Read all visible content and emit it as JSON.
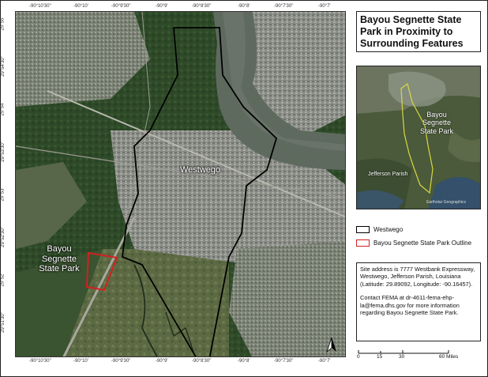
{
  "title": {
    "line1": "Bayou Segnette State",
    "line2": "Park in Proximity to",
    "line3": "Surrounding Features"
  },
  "map": {
    "labels": {
      "westwego": "Westwego",
      "bayou_line1": "Bayou",
      "bayou_line2": "Segnette",
      "bayou_line3": "State Park"
    },
    "longitude_ticks": [
      "-90°10'30\"",
      "-90°10'",
      "-90°9'30\"",
      "-90°9'",
      "-90°8'30\"",
      "-90°8'",
      "-90°7'30\"",
      "-90°7'"
    ],
    "latitude_ticks": [
      "29°55'",
      "29°54'30\"",
      "29°54'",
      "29°53'30\"",
      "29°53'",
      "29°52'30\"",
      "29°52'",
      "29°51'30\""
    ],
    "colors": {
      "westwego_outline": "#000000",
      "park_outline": "#d42020",
      "river": "#5f6a5f",
      "vegetation": "#2f4a2a"
    }
  },
  "inset": {
    "park_line1": "Bayou",
    "park_line2": "Segnette",
    "park_line3": "State Park",
    "parish": "Jefferson Parish",
    "credit": "Earthstar Geographics",
    "outline_color": "#d8d840"
  },
  "legend": {
    "items": [
      {
        "label": "Westwego",
        "color": "#000000"
      },
      {
        "label": "Bayou Segnette State Park Outline",
        "color": "#d42020"
      }
    ]
  },
  "info": {
    "address": "Site address is 7777 Westbank Expressway, Westwego, Jefferson Parish, Louisiana (Latitude: 29.89092, Longitude: -90.16457).",
    "contact": "Contact FEMA at dr-4611-fema-ehp-la@fema.dhs.gov for more information regarding Bayou Segnette State Park."
  },
  "scalebar": {
    "labels": [
      "0",
      "15",
      "30",
      "60 Miles"
    ]
  }
}
